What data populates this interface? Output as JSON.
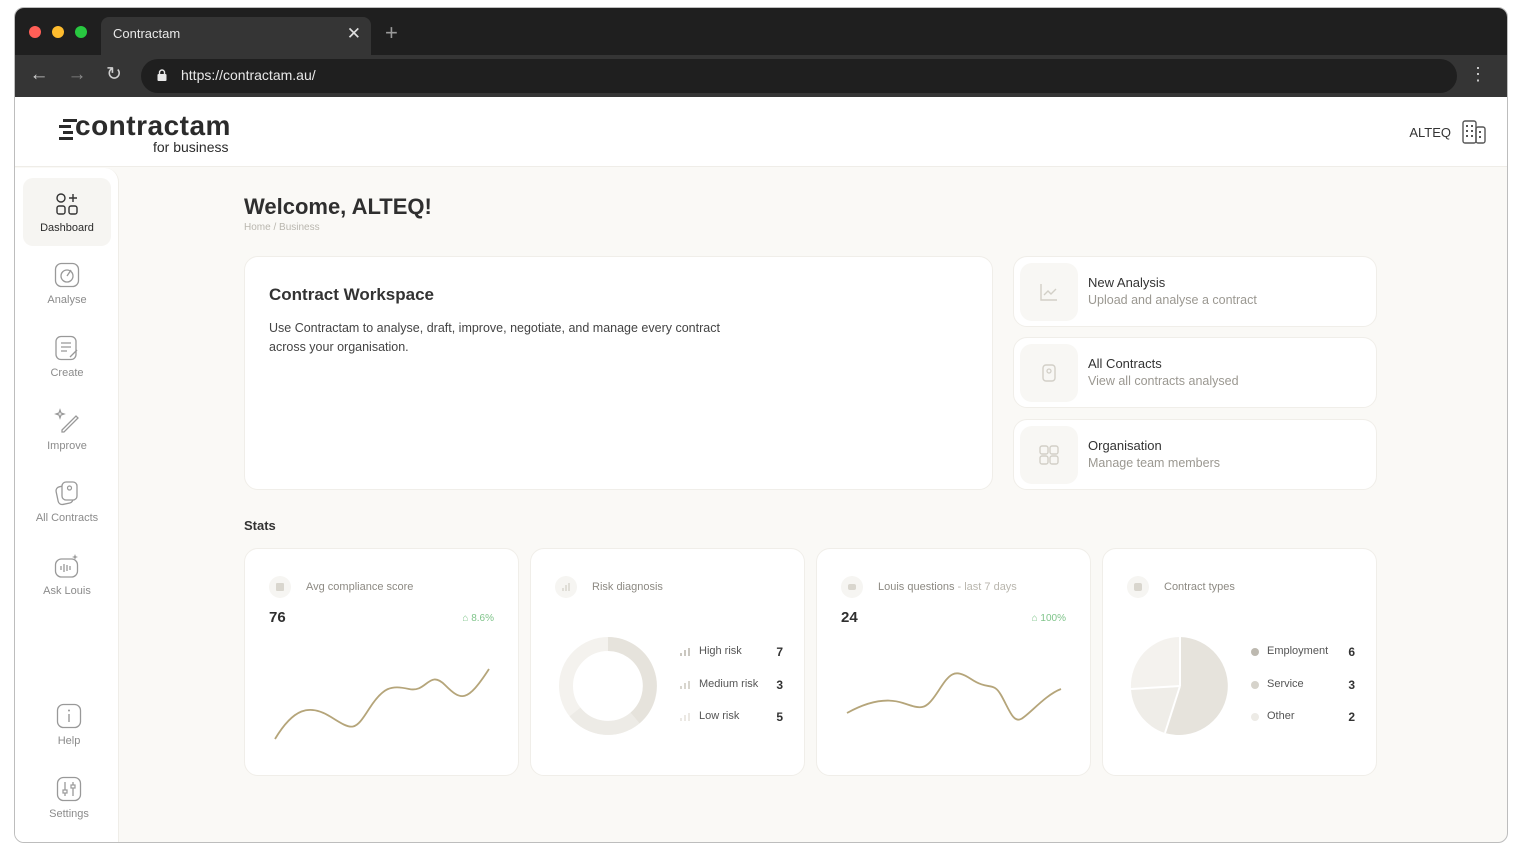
{
  "browser": {
    "tab_title": "Contractam",
    "url": "https://contractam.au/"
  },
  "header": {
    "logo_text": "contractam",
    "logo_sub": "for business",
    "org_name": "ALTEQ"
  },
  "sidebar": {
    "items": [
      {
        "label": "Dashboard",
        "icon": "dashboard-icon"
      },
      {
        "label": "Analyse",
        "icon": "analyse-icon"
      },
      {
        "label": "Create",
        "icon": "create-icon"
      },
      {
        "label": "Improve",
        "icon": "improve-icon"
      },
      {
        "label": "All Contracts",
        "icon": "contracts-icon"
      },
      {
        "label": "Ask Louis",
        "icon": "ask-louis-icon"
      }
    ],
    "bottom": [
      {
        "label": "Help",
        "icon": "help-icon"
      },
      {
        "label": "Settings",
        "icon": "settings-icon"
      }
    ]
  },
  "main": {
    "welcome": "Welcome, ALTEQ!",
    "breadcrumb": [
      "Home",
      "Business"
    ],
    "workspace": {
      "title": "Contract Workspace",
      "description": "Use Contractam to analyse, draft, improve, negotiate, and manage every contract across your organisation."
    },
    "quick_actions": [
      {
        "title": "New Analysis",
        "subtitle": "Upload and analyse a contract"
      },
      {
        "title": "All Contracts",
        "subtitle": "View all contracts analysed"
      },
      {
        "title": "Organisation",
        "subtitle": "Manage team members"
      }
    ],
    "stats_label": "Stats",
    "stats": {
      "compliance": {
        "title": "Avg compliance score",
        "value": "76",
        "delta": "8.6%"
      },
      "risk": {
        "title": "Risk diagnosis",
        "items": [
          {
            "label": "High risk",
            "count": "7"
          },
          {
            "label": "Medium risk",
            "count": "3"
          },
          {
            "label": "Low risk",
            "count": "5"
          }
        ]
      },
      "louis": {
        "title": "Louis questions",
        "title_suffix": " - last 7 days",
        "value": "24",
        "delta": "100%"
      },
      "types": {
        "title": "Contract types",
        "items": [
          {
            "label": "Employment",
            "count": "6"
          },
          {
            "label": "Service",
            "count": "3"
          },
          {
            "label": "Other",
            "count": "2"
          }
        ]
      }
    }
  },
  "colors": {
    "accent_line": "#b5a57a",
    "positive": "#7fc48a"
  }
}
